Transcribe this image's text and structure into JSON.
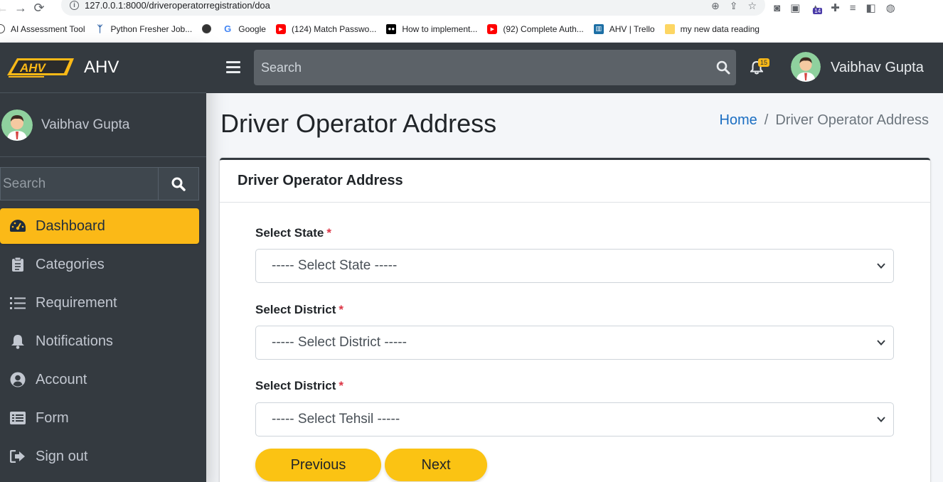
{
  "browser": {
    "url": "127.0.0.1:8000/driveroperatorregistration/doa",
    "extension_badge": "14",
    "bookmarks": [
      {
        "label": "AI Assessment Tool",
        "icon": "globe-icon"
      },
      {
        "label": "Python Fresher Job...",
        "icon": "python-icon"
      },
      {
        "label": "",
        "icon": "globe-icon"
      },
      {
        "label": "Google",
        "icon": "google-icon"
      },
      {
        "label": "(124) Match Passwo...",
        "icon": "youtube-icon"
      },
      {
        "label": "How to implement...",
        "icon": "medium-icon"
      },
      {
        "label": "(92) Complete Auth...",
        "icon": "youtube-icon"
      },
      {
        "label": "AHV | Trello",
        "icon": "trello-icon"
      },
      {
        "label": "my new data reading",
        "icon": "folder-icon"
      }
    ]
  },
  "sidebar": {
    "brand": "AHV",
    "logo_text": "AHV",
    "user_name": "Vaibhav Gupta",
    "search_placeholder": "Search",
    "menu": [
      {
        "label": "Dashboard",
        "icon": "dashboard-icon",
        "active": true
      },
      {
        "label": "Categories",
        "icon": "clipboard-icon",
        "active": false
      },
      {
        "label": "Requirement",
        "icon": "list-icon",
        "active": false
      },
      {
        "label": "Notifications",
        "icon": "bell-icon",
        "active": false
      },
      {
        "label": "Account",
        "icon": "user-circle-icon",
        "active": false
      },
      {
        "label": "Form",
        "icon": "form-icon",
        "active": false
      },
      {
        "label": "Sign out",
        "icon": "sign-out-icon",
        "active": false
      }
    ]
  },
  "topbar": {
    "search_placeholder": "Search",
    "notification_count": "15",
    "user_name": "Vaibhav Gupta"
  },
  "page": {
    "title": "Driver Operator Address",
    "breadcrumb": {
      "home": "Home",
      "separator": "/",
      "current": "Driver Operator Address"
    }
  },
  "form": {
    "card_title": "Driver Operator Address",
    "required_marker": "*",
    "fields": [
      {
        "label": "Select State",
        "value": "----- Select State -----"
      },
      {
        "label": "Select District",
        "value": "----- Select District -----"
      },
      {
        "label": "Select District",
        "value": "----- Select Tehsil -----"
      }
    ],
    "previous_label": "Previous",
    "next_label": "Next"
  },
  "colors": {
    "accent": "#fbb917",
    "sidebar_bg": "#343a40",
    "link": "#1b6ec2"
  }
}
